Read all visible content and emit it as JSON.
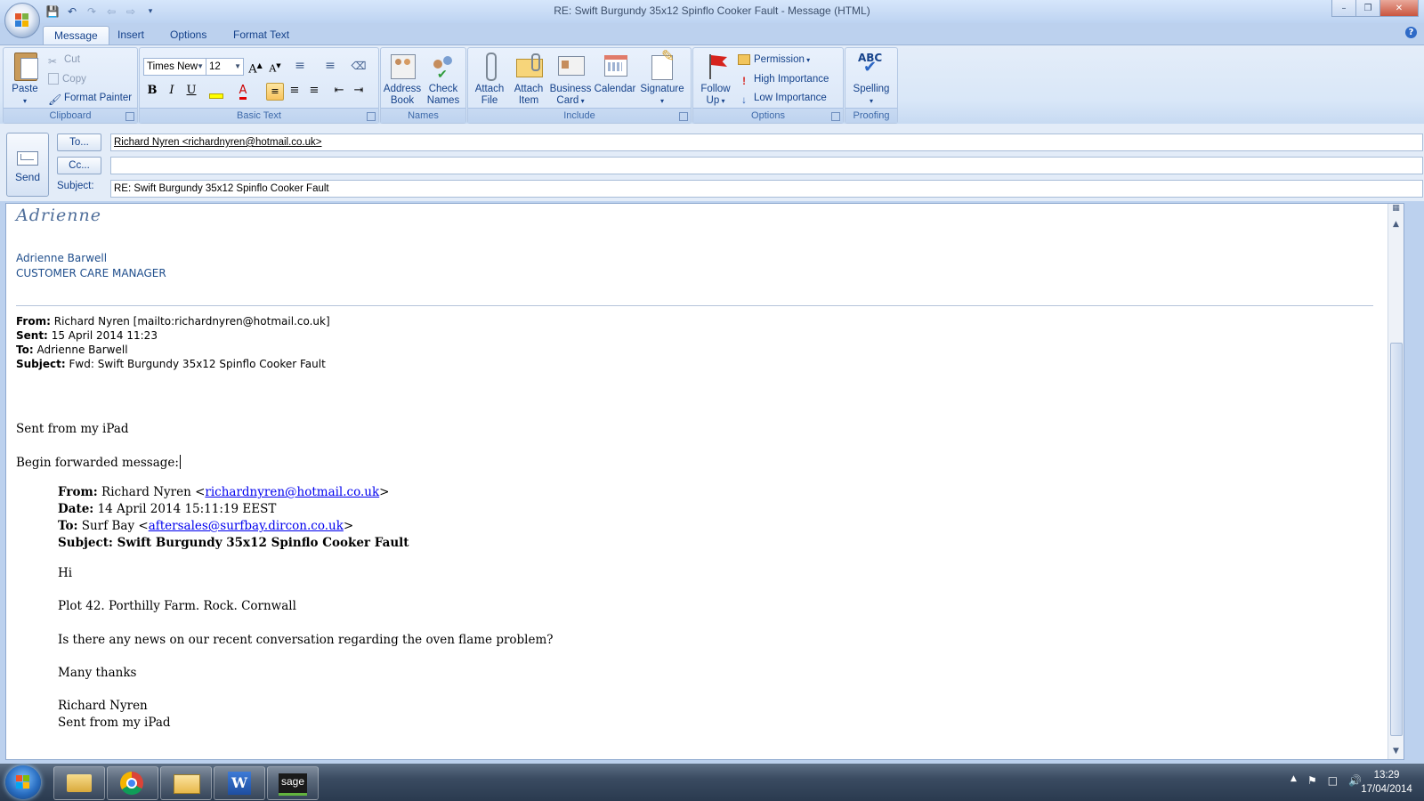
{
  "window": {
    "title": "RE: Swift Burgundy 35x12 Spinflo Cooker Fault - Message (HTML)",
    "minimize": "–",
    "restore": "❐",
    "close": "✕"
  },
  "quick_access": [
    "save-icon",
    "undo-icon",
    "redo-icon",
    "back-icon",
    "forward-icon",
    "customize-icon"
  ],
  "tabs": [
    "Message",
    "Insert",
    "Options",
    "Format Text"
  ],
  "ribbon": {
    "clipboard": {
      "label": "Clipboard",
      "paste": "Paste",
      "cut": "Cut",
      "copy": "Copy",
      "format_painter": "Format Painter"
    },
    "basic_text": {
      "label": "Basic Text",
      "font_name": "Times New",
      "font_size": "12",
      "bold": "B",
      "italic": "I",
      "underline": "U",
      "grow": "A",
      "shrink": "A"
    },
    "names": {
      "label": "Names",
      "address_book_1": "Address",
      "address_book_2": "Book",
      "check_names_1": "Check",
      "check_names_2": "Names"
    },
    "include": {
      "label": "Include",
      "attach_file_1": "Attach",
      "attach_file_2": "File",
      "attach_item_1": "Attach",
      "attach_item_2": "Item",
      "business_card_1": "Business",
      "business_card_2": "Card",
      "calendar": "Calendar",
      "signature": "Signature"
    },
    "options": {
      "label": "Options",
      "follow_up_1": "Follow",
      "follow_up_2": "Up",
      "permission": "Permission",
      "high_importance": "High Importance",
      "low_importance": "Low Importance"
    },
    "proofing": {
      "label": "Proofing",
      "spelling": "Spelling",
      "abc": "ABC"
    }
  },
  "header": {
    "send": "Send",
    "to_button": "To...",
    "cc_button": "Cc...",
    "subject_label": "Subject:",
    "to_value": "Richard Nyren <richardnyren@hotmail.co.uk>",
    "cc_value": "",
    "subject_value": "RE: Swift Burgundy 35x12 Spinflo Cooker Fault"
  },
  "body": {
    "signature_script": "Adrienne",
    "signature_name": "Adrienne Barwell",
    "signature_title": "CUSTOMER CARE MANAGER",
    "quoted_header": {
      "from_label": "From:",
      "from_value": "Richard Nyren [mailto:richardnyren@hotmail.co.uk]",
      "sent_label": "Sent:",
      "sent_value": "15 April 2014 11:23",
      "to_label": "To:",
      "to_value": "Adrienne Barwell",
      "subject_label": "Subject:",
      "subject_value": "Fwd: Swift Burgundy 35x12 Spinflo Cooker Fault"
    },
    "sent_from_ipad": "Sent from my iPad",
    "begin_forwarded": "Begin forwarded message:",
    "forwarded": {
      "from_label": "From:",
      "from_name": "Richard Nyren <",
      "from_email": "richardnyren@hotmail.co.uk",
      "from_close": ">",
      "date_label": "Date:",
      "date_value": "14 April 2014 15:11:19 EEST",
      "to_label": "To:",
      "to_name": "Surf Bay <",
      "to_email": "aftersales@surfbay.dircon.co.uk",
      "to_close": ">",
      "subject_label": "Subject:",
      "subject_value": "Swift Burgundy 35x12 Spinflo Cooker Fault",
      "greeting": "Hi",
      "address": "Plot 42. Porthilly Farm. Rock. Cornwall",
      "question": "Is there any news on our recent conversation regarding the oven flame problem?",
      "thanks": "Many thanks",
      "signoff_name": "Richard Nyren",
      "signoff_device": "Sent from my iPad"
    }
  },
  "taskbar": {
    "apps": [
      "windows-explorer-icon",
      "chrome-icon",
      "outlook-icon",
      "word-icon",
      "sage-icon"
    ],
    "sage_label": "sage",
    "word_label": "W",
    "time": "13:29",
    "date": "17/04/2014"
  },
  "colors": {
    "ribbon_bg": "#dce8f8",
    "accent_blue": "#15428b",
    "link": "#0000ee",
    "signature": "#1f4e8c"
  }
}
